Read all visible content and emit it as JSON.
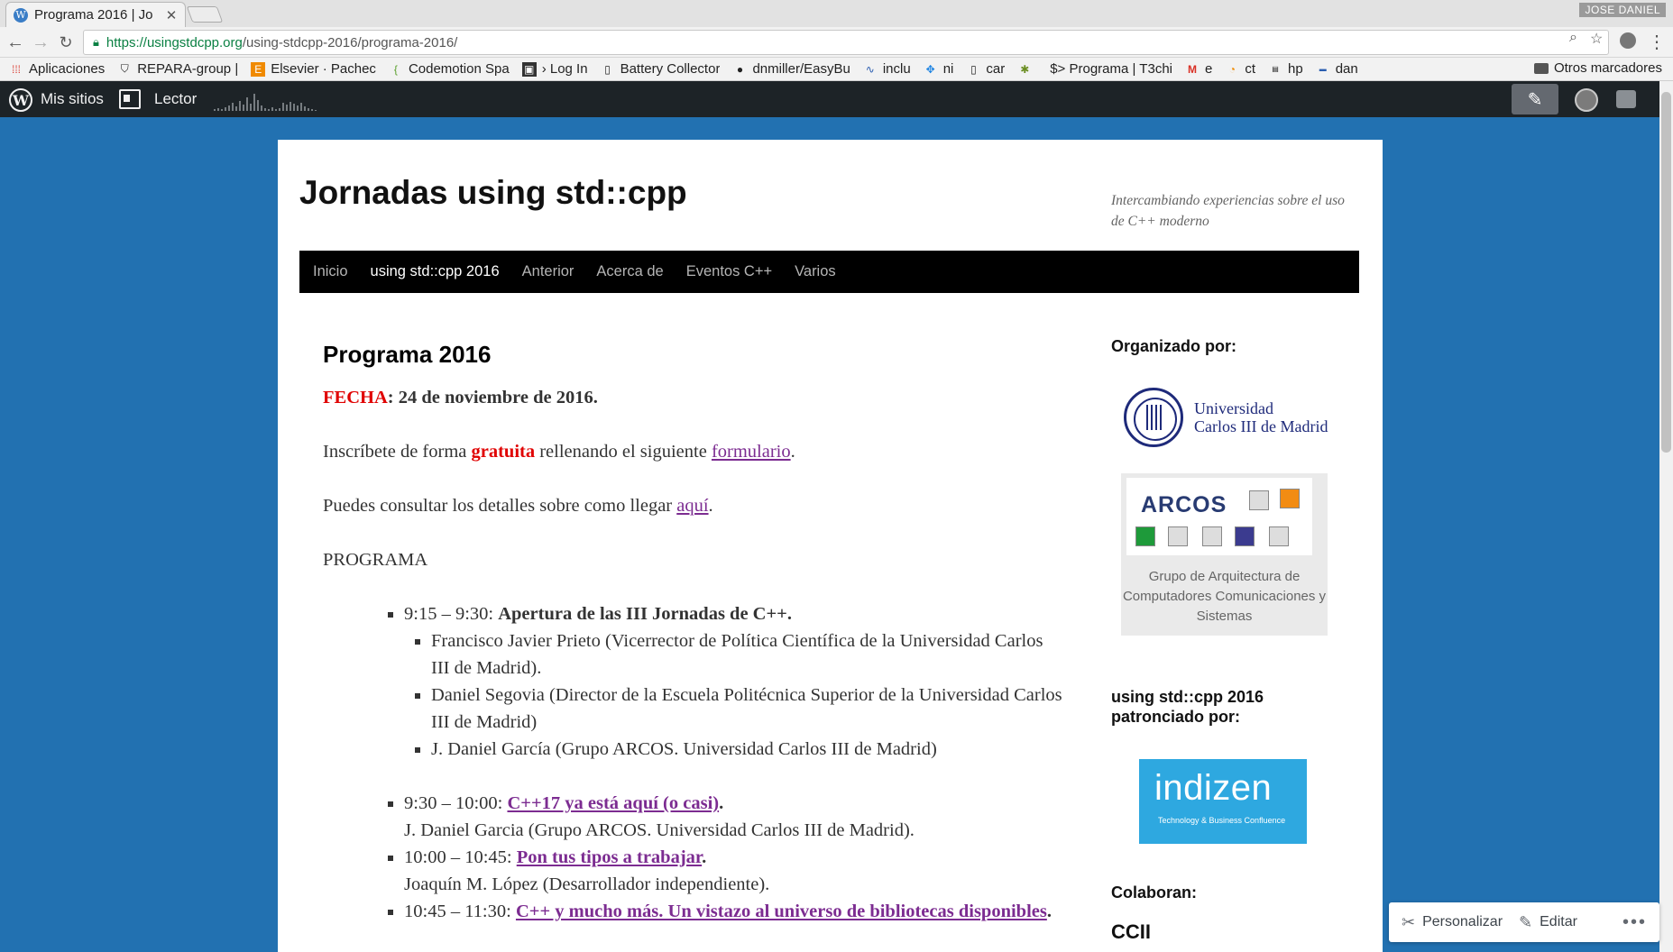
{
  "browser": {
    "tab_title": "Programa 2016 | Jo",
    "user_tag": "JOSE DANIEL",
    "url_host": "https://usingstdcpp.org",
    "url_path": "/using-stdcpp-2016/programa-2016/",
    "bookmarks": [
      {
        "icon": "apps-grid-icon",
        "label": "Aplicaciones"
      },
      {
        "icon": "shield-icon",
        "label": "REPARA-group | "
      },
      {
        "icon": "elsevier-icon",
        "label": "Elsevier · Pachec"
      },
      {
        "icon": "codemotion-icon",
        "label": "Codemotion Spa"
      },
      {
        "icon": "login-icon",
        "label": "› Log In"
      },
      {
        "icon": "page-icon",
        "label": "Battery Collector"
      },
      {
        "icon": "github-icon",
        "label": "dnmiller/EasyBu"
      },
      {
        "icon": "wave-icon",
        "label": "inclu"
      },
      {
        "icon": "dropbox-icon",
        "label": "ni"
      },
      {
        "icon": "page-icon",
        "label": "car"
      },
      {
        "icon": "bug-icon",
        "label": ""
      },
      {
        "icon": "terminal-icon",
        "label": "$> Programa | T3chi"
      },
      {
        "icon": "gmail-icon",
        "label": "e"
      },
      {
        "icon": "rss-icon",
        "label": "ct"
      },
      {
        "icon": "hp-icon",
        "label": "hp"
      },
      {
        "icon": "dan-icon",
        "label": "dan"
      }
    ],
    "other_bookmarks": "Otros marcadores"
  },
  "wpbar": {
    "my_sites": "Mis sitios",
    "reader": "Lector"
  },
  "site": {
    "title": "Jornadas using std::cpp",
    "description": "Intercambiando experiencias sobre el uso de C++ moderno",
    "nav": [
      "Inicio",
      "using std::cpp 2016",
      "Anterior",
      "Acerca de",
      "Eventos C++",
      "Varios"
    ]
  },
  "post": {
    "title": "Programa 2016",
    "date_label": "FECHA",
    "date_value": ": 24 de noviembre de 2016.",
    "signup_before": "Inscríbete de forma ",
    "signup_bold": "gratuita",
    "signup_middle": " rellenando el siguiente ",
    "signup_link": "formulario",
    "signup_after": ".",
    "directions_before": "Puedes consultar los detalles sobre como llegar ",
    "directions_link": "aquí",
    "directions_after": ".",
    "programa_heading": "PROGRAMA",
    "s1_time": "9:15 – 9:30: ",
    "s1_title": "Apertura de las III Jornadas de C++.",
    "s1_speakers": [
      "Francisco Javier Prieto (Vicerrector de Política Científica de la Universidad Carlos III de Madrid).",
      "Daniel Segovia (Director de la Escuela Politécnica Superior de la Universidad Carlos III de Madrid)",
      "J. Daniel García (Grupo ARCOS. Universidad Carlos III de Madrid)"
    ],
    "s2_time": "9:30 – 10:00: ",
    "s2_title": "C++17 ya está aquí (o casi)",
    "s2_speaker": "J. Daniel Garcia (Grupo ARCOS. Universidad Carlos III de Madrid).",
    "s3_time": "10:00 – 10:45: ",
    "s3_title": "Pon tus tipos a trabajar",
    "s3_speaker": "Joaquín M. López (Desarrollador independiente).",
    "s4_time": "10:45 – 11:30: ",
    "s4_title": "C++ y mucho más. Un vistazo al universo de bibliotecas disponibles",
    "dot": "."
  },
  "sidebar": {
    "organized_by": "Organizado por:",
    "uc3m_line1": "Universidad",
    "uc3m_line2": "Carlos III de Madrid",
    "arcos_word": "ARCOS",
    "arcos_caption": "Grupo de Arquitectura de Computadores Comunicaciones y Sistemas",
    "sponsored_by_1": "using std::cpp 2016",
    "sponsored_by_2": "patronciado por:",
    "indizen_name": "indizen",
    "indizen_slogan": "Technology & Business Confluence",
    "collaborate": "Colaboran:",
    "ccii": "CCII"
  },
  "customizer": {
    "customize": "Personalizar",
    "edit": "Editar"
  },
  "colors": {
    "wp_blue": "#2271b1",
    "admin_bar": "#1d2327",
    "link_purple": "#7c2c91",
    "date_red": "#e00000",
    "indizen_blue": "#2ea8e0"
  }
}
